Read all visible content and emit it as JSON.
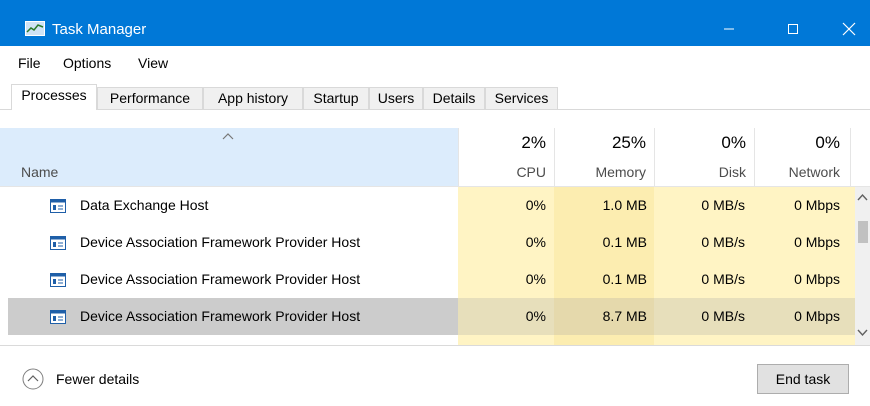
{
  "window": {
    "title": "Task Manager"
  },
  "menu": {
    "file": "File",
    "options": "Options",
    "view": "View"
  },
  "tabs": [
    "Processes",
    "Performance",
    "App history",
    "Startup",
    "Users",
    "Details",
    "Services"
  ],
  "columns": {
    "name": "Name",
    "cpu": {
      "pct": "2%",
      "label": "CPU"
    },
    "memory": {
      "pct": "25%",
      "label": "Memory"
    },
    "disk": {
      "pct": "0%",
      "label": "Disk"
    },
    "network": {
      "pct": "0%",
      "label": "Network"
    }
  },
  "rows": [
    {
      "name": "Data Exchange Host",
      "cpu": "0%",
      "memory": "1.0 MB",
      "disk": "0 MB/s",
      "network": "0 Mbps"
    },
    {
      "name": "Device Association Framework Provider Host",
      "cpu": "0%",
      "memory": "0.1 MB",
      "disk": "0 MB/s",
      "network": "0 Mbps"
    },
    {
      "name": "Device Association Framework Provider Host",
      "cpu": "0%",
      "memory": "0.1 MB",
      "disk": "0 MB/s",
      "network": "0 Mbps"
    },
    {
      "name": "Device Association Framework Provider Host",
      "cpu": "0%",
      "memory": "8.7 MB",
      "disk": "0 MB/s",
      "network": "0 Mbps"
    }
  ],
  "footer": {
    "fewer_details": "Fewer details",
    "end_task": "End task"
  },
  "colors": {
    "titlebar": "#0078d7",
    "heat_light": "#fff4c4",
    "heat_memory": "#fcedb0",
    "selected": "#cccccc"
  }
}
